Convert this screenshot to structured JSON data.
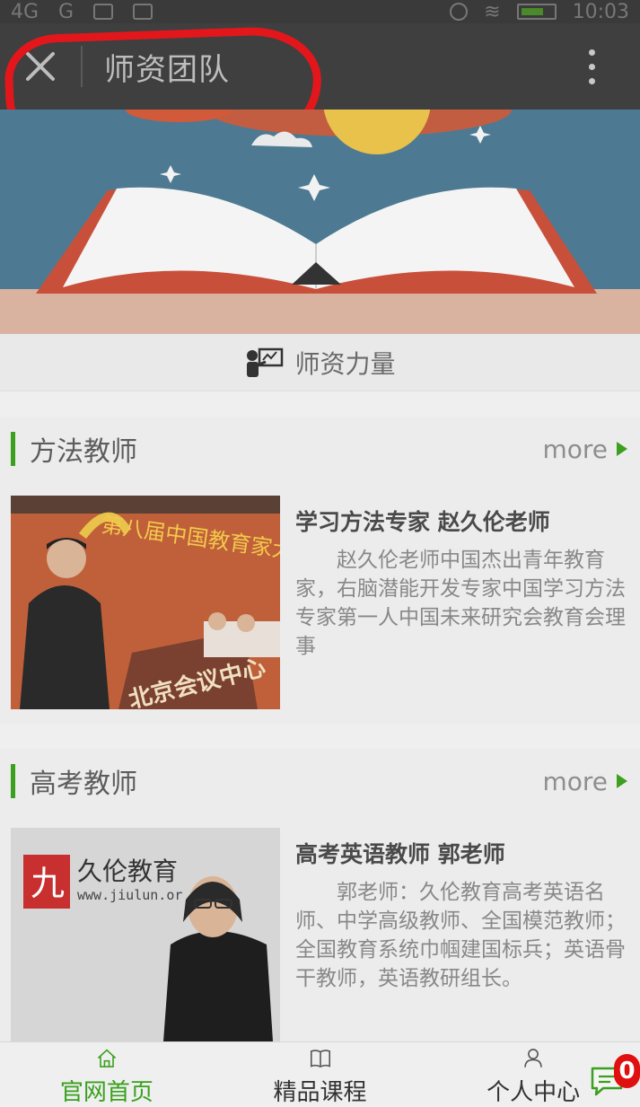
{
  "status_bar": {
    "network_1": "4G",
    "network_2": "G",
    "time": "10:03"
  },
  "title_bar": {
    "title": "师资团队",
    "close_icon": "close-icon",
    "menu_icon": "more-vertical-icon"
  },
  "section": {
    "title": "师资力量",
    "icon": "teacher-board-icon"
  },
  "categories": [
    {
      "title": "方法教师",
      "more_label": "more",
      "teacher": {
        "name": "学习方法专家 赵久伦老师",
        "description": "赵久伦老师中国杰出青年教育家，右脑潜能开发专家中国学习方法专家第一人中国未来研究会教育会理事",
        "photo_banner_text": "第八届中国教育家大会",
        "photo_podium_text": "北京会议中心"
      }
    },
    {
      "title": "高考教师",
      "more_label": "more",
      "teacher": {
        "name": "高考英语教师 郭老师",
        "description": "郭老师：久伦教育高考英语名师、中学高级教师、全国模范教师；全国教育系统巾帼建国标兵；英语骨干教师，英语教研组长。",
        "photo_logo_text": "久伦教育",
        "photo_url_text": "www.jiulun.or"
      }
    }
  ],
  "tab_bar": {
    "tabs": [
      {
        "label": "官网首页",
        "icon": "home-icon",
        "active": true
      },
      {
        "label": "精品课程",
        "icon": "book-icon",
        "active": false
      },
      {
        "label": "个人中心",
        "icon": "user-icon",
        "active": false
      }
    ],
    "chat_badge": "0"
  },
  "colors": {
    "accent": "#3aa01e",
    "annotation": "#e3171b",
    "title_bar": "#3f3f3f",
    "badge": "#e01010"
  }
}
